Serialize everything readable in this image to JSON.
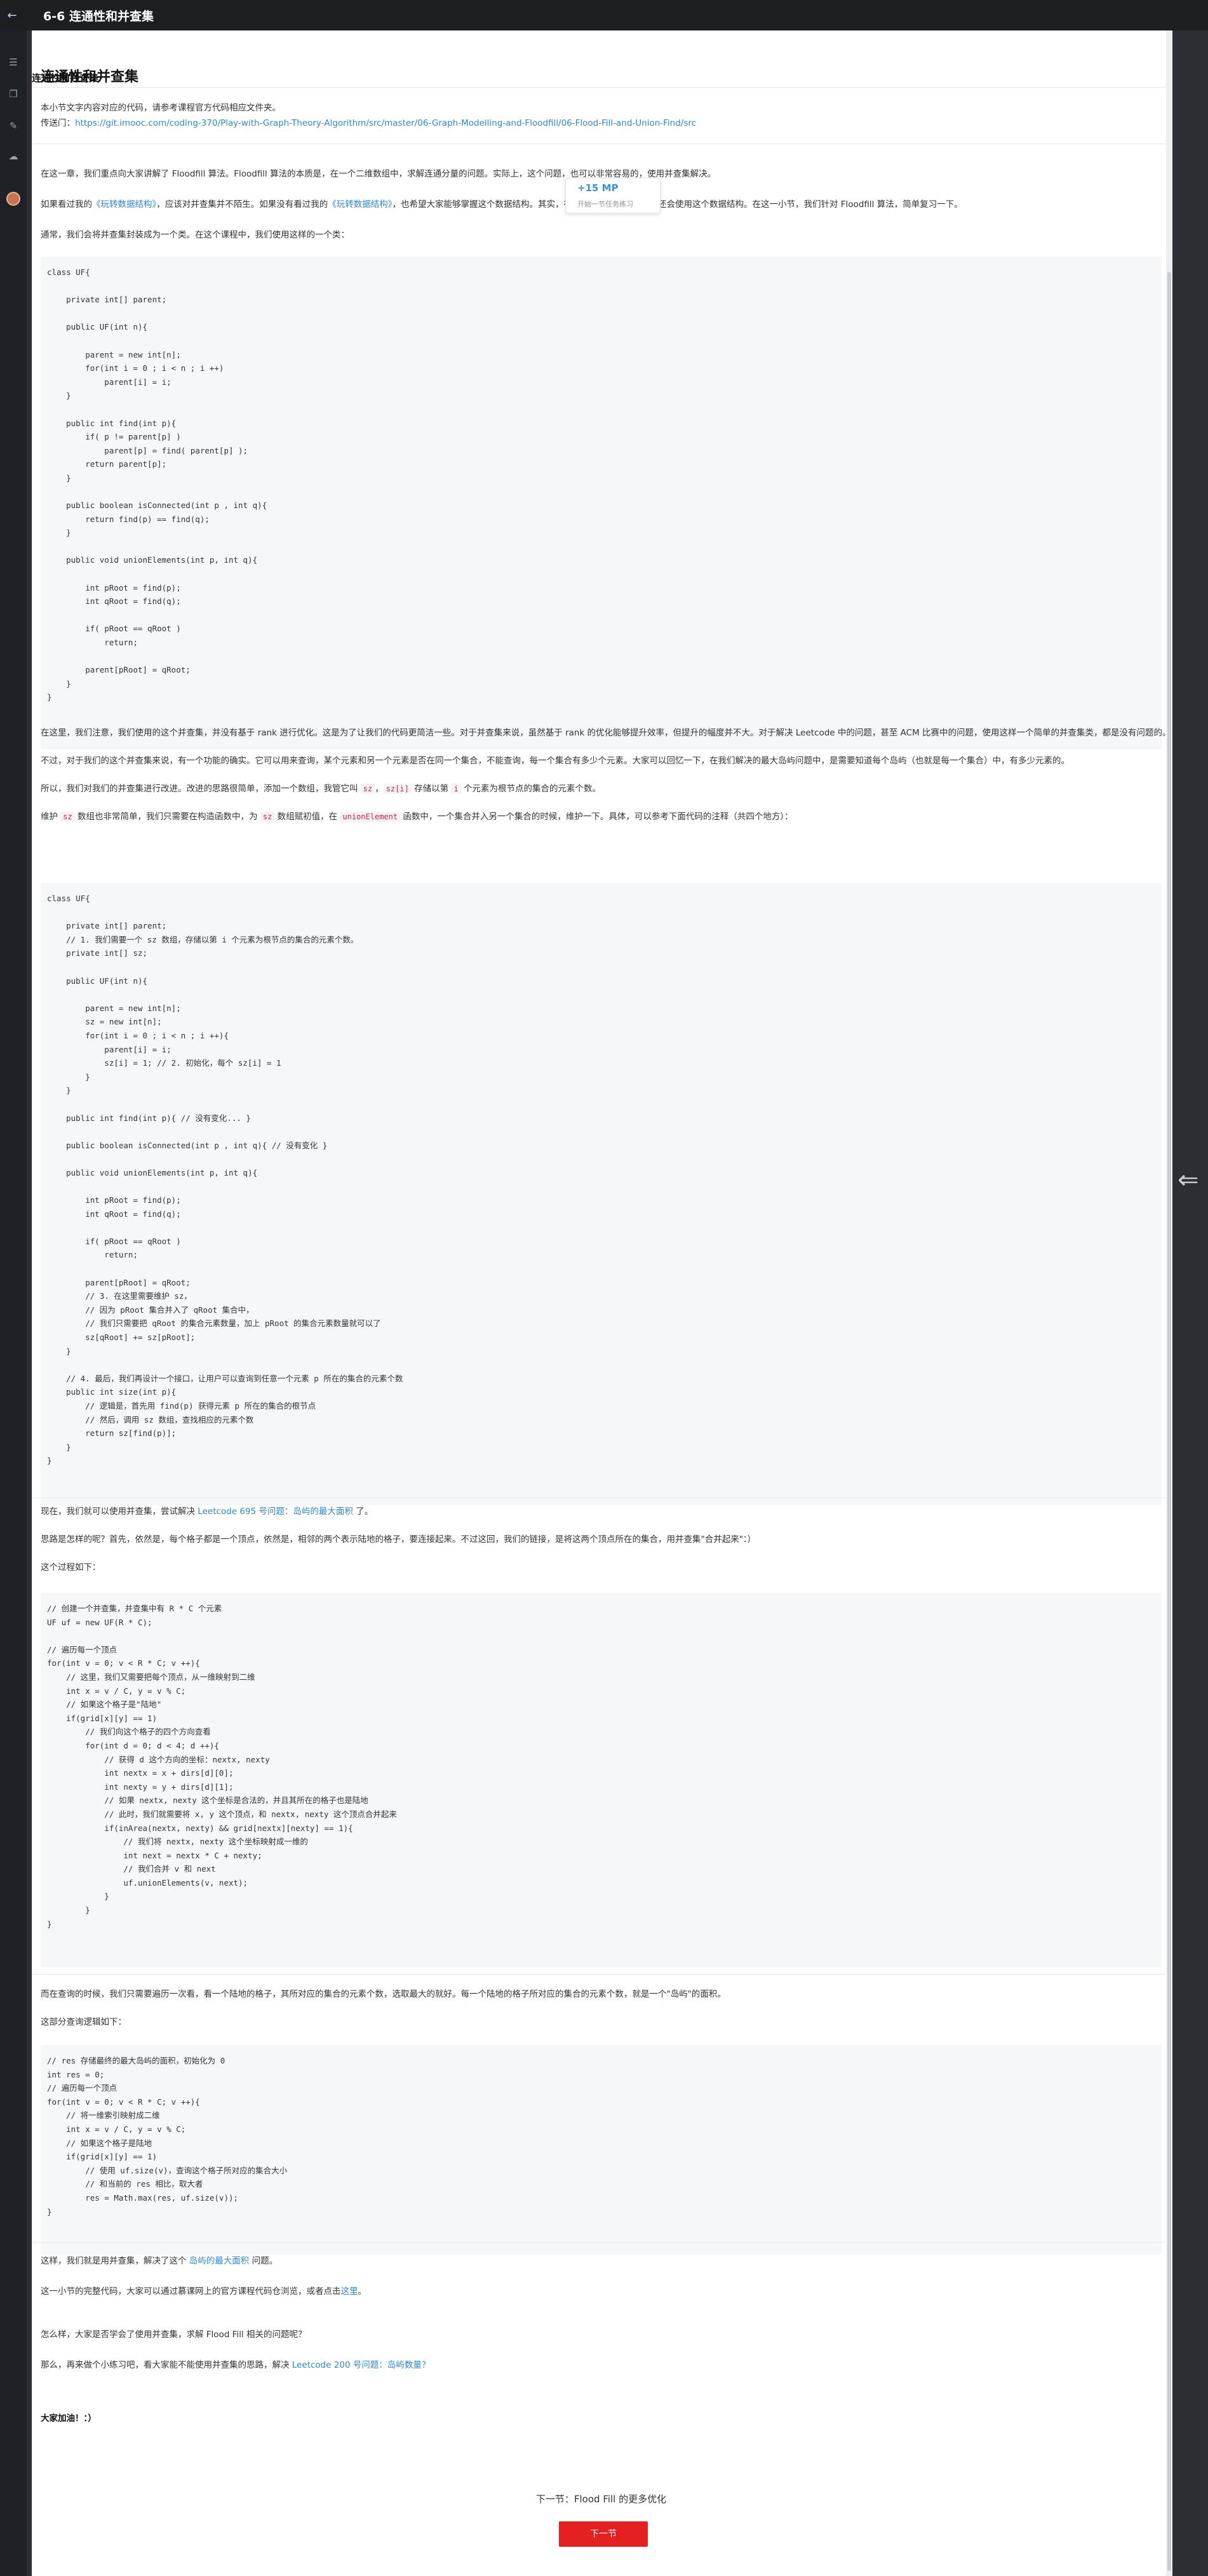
{
  "header": {
    "back_icon": "arrow-left-icon",
    "title": "6-6 连通性和并查集"
  },
  "tabstrip": {
    "title": "连通性和并查集"
  },
  "article": {
    "h1": "连通性和并查集",
    "intro": "本小节文字内容对应的代码，请参考课程官方代码相应文件夹。",
    "portal_prefix": "传送门：",
    "portal_url": "https://git.imooc.com/coding-370/Play-with-Graph-Theory-Algorithm/src/master/06-Graph-Modelling-and-Floodfill/06-Flood-Fill-and-Union-Find/src",
    "p1": "在这一章，我们重点向大家讲解了 Floodfill 算法。Floodfill 算法的本质是，在一个二维数组中，求解连通分量的问题。实际上，这个问题，也可以非常容易的，使用并查集解决。",
    "p2": {
      "a": "如果看过我的",
      "link1": "《玩转数据结构》",
      "b": "，应该对并查集并不陌生。如果没有看过我的",
      "link2": "《玩转数据结构》",
      "c": "，也希望大家能够掌握这个数据结构。其实，在这个课程的后续，我们还会使用这个数据结构。在这一小节，我们针对 Floodfill 算法，简单复习一下。"
    },
    "p3": "通常，我们会将并查集封装成为一个类。在这个课程中，我们使用这样的一个类：",
    "code1": "class UF{\n\n    private int[] parent;\n\n    public UF(int n){\n\n        parent = new int[n];\n        for(int i = 0 ; i < n ; i ++)\n            parent[i] = i;\n    }\n\n    public int find(int p){\n        if( p != parent[p] )\n            parent[p] = find( parent[p] );\n        return parent[p];\n    }\n\n    public boolean isConnected(int p , int q){\n        return find(p) == find(q);\n    }\n\n    public void unionElements(int p, int q){\n\n        int pRoot = find(p);\n        int qRoot = find(q);\n\n        if( pRoot == qRoot )\n            return;\n\n        parent[pRoot] = qRoot;\n    }\n}",
    "p4": "在这里，我们注意，我们使用的这个并查集，并没有基于 rank 进行优化。这是为了让我们的代码更简洁一些。对于并查集来说，虽然基于 rank 的优化能够提升效率，但提升的幅度并不大。对于解决 Leetcode 中的问题，甚至 ACM 比赛中的问题，使用这样一个简单的并查集类，都是没有问题的。",
    "p5": "不过，对于我们的这个并查集来说，有一个功能的确实。它可以用来查询，某个元素和另一个元素是否在同一个集合，不能查询，每一个集合有多少个元素。大家可以回忆一下，在我们解决的最大岛屿问题中，是需要知道每个岛屿（也就是每一个集合）中，有多少元素的。",
    "p6": {
      "a": "所以，我们对我们的并查集进行改进。改进的思路很简单，添加一个数组，我管它叫 ",
      "c1": "sz",
      "b": "，",
      "c2": "sz[i]",
      "c": " 存储以第 ",
      "c3": "i",
      "d": " 个元素为根节点的集合的元素个数。"
    },
    "p7": {
      "a": "维护 ",
      "c1": "sz",
      "b": " 数组也非常简单，我们只需要在构造函数中，为 ",
      "c2": "sz",
      "c": " 数组赋初值，在 ",
      "c3": "unionElement",
      "d": " 函数中，一个集合并入另一个集合的时候，维护一下。具体，可以参考下面代码的注释（共四个地方）："
    },
    "code2": "class UF{\n\n    private int[] parent;\n    // 1. 我们需要一个 sz 数组，存储以第 i 个元素为根节点的集合的元素个数。\n    private int[] sz;\n\n    public UF(int n){\n\n        parent = new int[n];\n        sz = new int[n];\n        for(int i = 0 ; i < n ; i ++){\n            parent[i] = i;\n            sz[i] = 1; // 2. 初始化，每个 sz[i] = 1\n        }\n    }\n\n    public int find(int p){ // 没有变化... }\n\n    public boolean isConnected(int p , int q){ // 没有变化 }\n\n    public void unionElements(int p, int q){\n\n        int pRoot = find(p);\n        int qRoot = find(q);\n\n        if( pRoot == qRoot )\n            return;\n\n        parent[pRoot] = qRoot;\n        // 3. 在这里需要维护 sz，\n        // 因为 pRoot 集合并入了 qRoot 集合中，\n        // 我们只需要把 qRoot 的集合元素数量，加上 pRoot 的集合元素数量就可以了\n        sz[qRoot] += sz[pRoot];\n    }\n\n    // 4. 最后，我们再设计一个接口，让用户可以查询到任意一个元素 p 所在的集合的元素个数\n    public int size(int p){\n        // 逻辑是，首先用 find(p) 获得元素 p 所在的集合的根节点\n        // 然后，调用 sz 数组，查找相应的元素个数\n        return sz[find(p)];\n    }\n}",
    "p8": {
      "a": "现在，我们就可以使用并查集，尝试解决 ",
      "link": "Leetcode 695 号问题：岛屿的最大面积",
      "b": " 了。"
    },
    "p9": "思路是怎样的呢？首先，依然是，每个格子都是一个顶点，依然是，相邻的两个表示陆地的格子，要连接起来。不过这回，我们的链接，是将这两个顶点所在的集合，用并查集\"合并起来\"：）",
    "p10": "这个过程如下：",
    "code3": "// 创建一个并查集，并查集中有 R * C 个元素\nUF uf = new UF(R * C);\n\n// 遍历每一个顶点\nfor(int v = 0; v < R * C; v ++){\n    // 这里，我们又需要把每个顶点，从一维映射到二维\n    int x = v / C, y = v % C;\n    // 如果这个格子是\"陆地\"\n    if(grid[x][y] == 1)\n        // 我们向这个格子的四个方向查看\n        for(int d = 0; d < 4; d ++){\n            // 获得 d 这个方向的坐标：nextx, nexty\n            int nextx = x + dirs[d][0];\n            int nexty = y + dirs[d][1];\n            // 如果 nextx, nexty 这个坐标是合法的，并且其所在的格子也是陆地\n            // 此时，我们就需要将 x, y 这个顶点，和 nextx, nexty 这个顶点合并起来\n            if(inArea(nextx, nexty) && grid[nextx][nexty] == 1){\n                // 我们将 nextx, nexty 这个坐标映射成一维的\n                int next = nextx * C + nexty;\n                // 我们合并 v 和 next\n                uf.unionElements(v, next);\n            }\n        }\n}",
    "p11": "而在查询的时候，我们只需要遍历一次看，看一个陆地的格子，其所对应的集合的元素个数，选取最大的就好。每一个陆地的格子所对应的集合的元素个数，就是一个\"岛屿\"的面积。",
    "p12": "这部分查询逻辑如下：",
    "code4": "// res 存储最终的最大岛屿的面积，初始化为 0\nint res = 0;\n// 遍历每一个顶点\nfor(int v = 0; v < R * C; v ++){\n    // 将一维索引映射成二维\n    int x = v / C, y = v % C;\n    // 如果这个格子是陆地\n    if(grid[x][y] == 1)\n        // 使用 uf.size(v)，查询这个格子所对应的集合大小\n        // 和当前的 res 相比，取大者\n        res = Math.max(res, uf.size(v));\n}",
    "p13": {
      "a": "这样，我们就是用并查集，解决了这个 ",
      "link": "岛屿的最大面积",
      "b": " 问题。"
    },
    "p14": {
      "a": "这一小节的完整代码，大家可以通过慕课网上的官方课程代码仓浏览，或者点击",
      "link": "这里",
      "b": "。"
    },
    "p15": "怎么样，大家是否学会了使用并查集，求解 Flood Fill 相关的问题呢？",
    "p16": {
      "a": "那么，再来做个小练习吧，看大家能不能使用并查集的思路，解决 ",
      "link": "Leetcode 200 号问题：岛屿数量？"
    },
    "p17": "大家加油！：）"
  },
  "badge": {
    "big": "+15 MP",
    "small": "开始一节任务练习"
  },
  "footer": {
    "next_text": "下一节：Flood Fill 的更多优化",
    "next_button": "下一节"
  },
  "sidebar_icons": [
    "menu-icon",
    "bookmark-icon",
    "edit-icon",
    "cloud-icon",
    "avatar"
  ],
  "rightgap": {
    "arrow_icon": "collapse-arrow-icon"
  },
  "colors": {
    "link": "#2d89c8",
    "accent": "#e41f1f",
    "code_bg": "#f6f7f8",
    "topbar": "#1c1f22"
  }
}
